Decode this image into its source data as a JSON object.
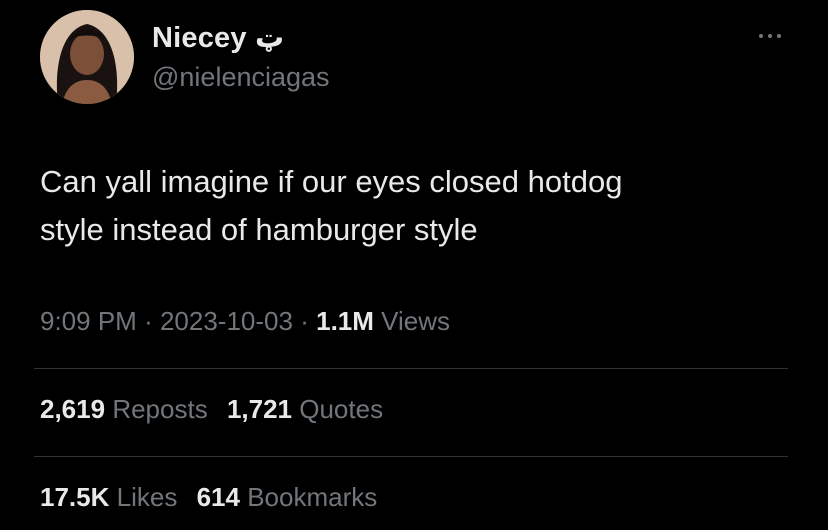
{
  "user": {
    "display_name": "Niecey",
    "name_emoji": "ټ",
    "handle": "@nielenciagas"
  },
  "tweet": {
    "lines": [
      "Can yall imagine if our eyes closed hotdog",
      "style instead of hamburger style"
    ],
    "time": "9:09 PM",
    "date": "2023-10-03",
    "views_count": "1.1M",
    "views_label": "Views",
    "separator": "·"
  },
  "stats": {
    "reposts_count": "2,619",
    "reposts_label": "Reposts",
    "quotes_count": "1,721",
    "quotes_label": "Quotes",
    "likes_count": "17.5K",
    "likes_label": "Likes",
    "bookmarks_count": "614",
    "bookmarks_label": "Bookmarks"
  },
  "icons": {
    "more": "more-horizontal-icon"
  },
  "colors": {
    "background": "#000000",
    "primary_text": "#e7e9ea",
    "secondary_text": "#71767b",
    "divider": "#2f3336"
  }
}
